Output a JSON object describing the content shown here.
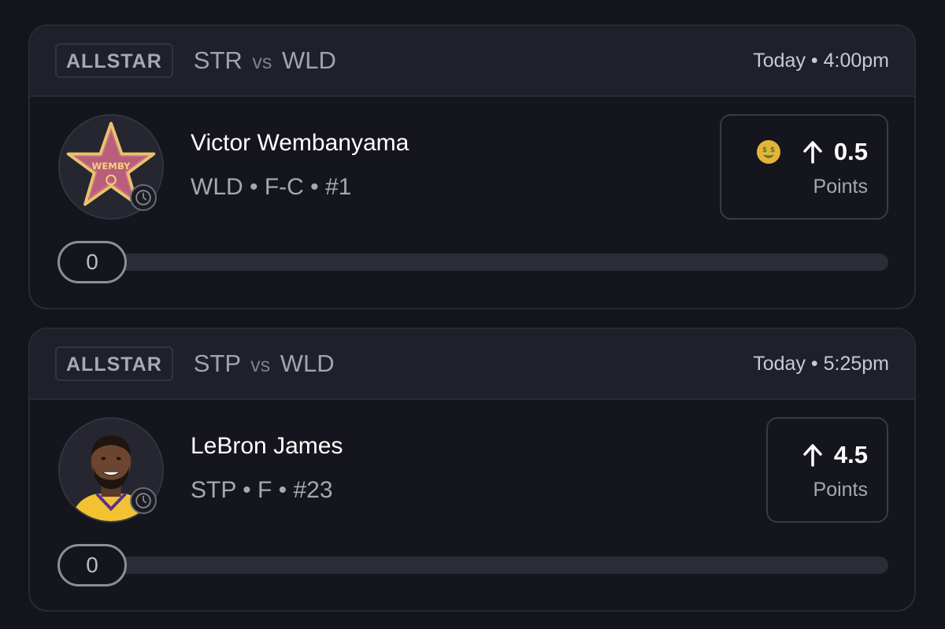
{
  "cards": [
    {
      "league": "ALLSTAR",
      "team_home": "STR",
      "vs": "vs",
      "team_away": "WLD",
      "time": "Today • 4:00pm",
      "player": {
        "name": "Victor Wembanyama",
        "meta": "WLD • F-C • #1",
        "avatar_icon": "wemby-star-icon",
        "avatar_text": "WEMBY"
      },
      "projection": {
        "value": "0.5",
        "label": "Points",
        "direction_icon": "arrow-up-icon",
        "badge_icon": "money-mouth-emoji-icon"
      },
      "progress": {
        "value": "0",
        "fraction": 0
      }
    },
    {
      "league": "ALLSTAR",
      "team_home": "STP",
      "vs": "vs",
      "team_away": "WLD",
      "time": "Today • 5:25pm",
      "player": {
        "name": "LeBron James",
        "meta": "STP • F • #23",
        "avatar_icon": "player-headshot-icon"
      },
      "projection": {
        "value": "4.5",
        "label": "Points",
        "direction_icon": "arrow-up-icon"
      },
      "progress": {
        "value": "0",
        "fraction": 0
      }
    }
  ],
  "colors": {
    "background": "#14141c",
    "card_header": "#20202a",
    "muted_text": "#a7a7b2",
    "star_pink": "#c76b86",
    "emoji_gold": "#e6b33a",
    "jersey_gold": "#f2c233"
  }
}
